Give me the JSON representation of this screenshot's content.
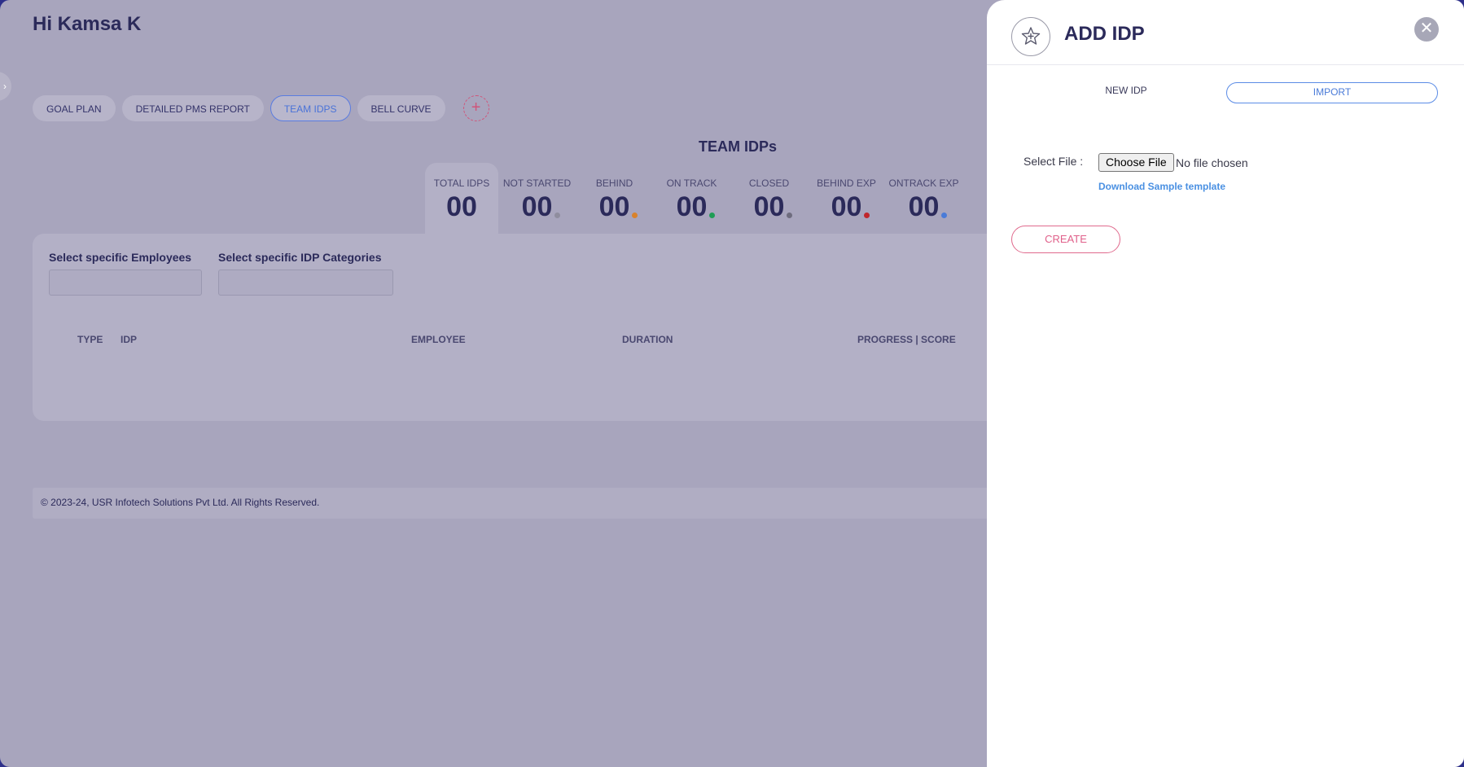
{
  "greeting": "Hi Kamsa K",
  "tabs": [
    {
      "label": "GOAL PLAN"
    },
    {
      "label": "DETAILED PMS REPORT"
    },
    {
      "label": "TEAM IDPS"
    },
    {
      "label": "BELL CURVE"
    }
  ],
  "active_tab": "TEAM IDPS",
  "add_tab_symbol": "+",
  "section_title": "TEAM IDPs",
  "stats": [
    {
      "label": "TOTAL IDPS",
      "value": "00",
      "dot_color": ""
    },
    {
      "label": "NOT STARTED",
      "value": "00",
      "dot_color": "#8f8d9e"
    },
    {
      "label": "BEHIND",
      "value": "00",
      "dot_color": "#d9822b"
    },
    {
      "label": "ON TRACK",
      "value": "00",
      "dot_color": "#1f9d55"
    },
    {
      "label": "CLOSED",
      "value": "00",
      "dot_color": "#6e6c7e"
    },
    {
      "label": "BEHIND EXP",
      "value": "00",
      "dot_color": "#c0262c"
    },
    {
      "label": "ONTRACK EXP",
      "value": "00",
      "dot_color": "#4a7bd8"
    }
  ],
  "filters": {
    "employees_label": "Select specific Employees",
    "categories_label": "Select specific IDP Categories"
  },
  "table": {
    "columns": [
      "TYPE",
      "IDP",
      "EMPLOYEE",
      "DURATION",
      "PROGRESS | SCORE"
    ]
  },
  "footer": "© 2023-24, USR Infotech Solutions Pvt Ltd. All Rights Reserved.",
  "drawer": {
    "title": "ADD IDP",
    "close_symbol": "✕",
    "mode_new": "NEW IDP",
    "mode_import": "IMPORT",
    "file_label": "Select File :",
    "file_button": "Choose File",
    "file_status": "No file chosen",
    "download_link": "Download Sample template",
    "create_button": "CREATE"
  },
  "colors": {
    "accent_blue": "#4a7bd8",
    "accent_pink": "#e0608a",
    "title_dark": "#2b2a5a"
  }
}
